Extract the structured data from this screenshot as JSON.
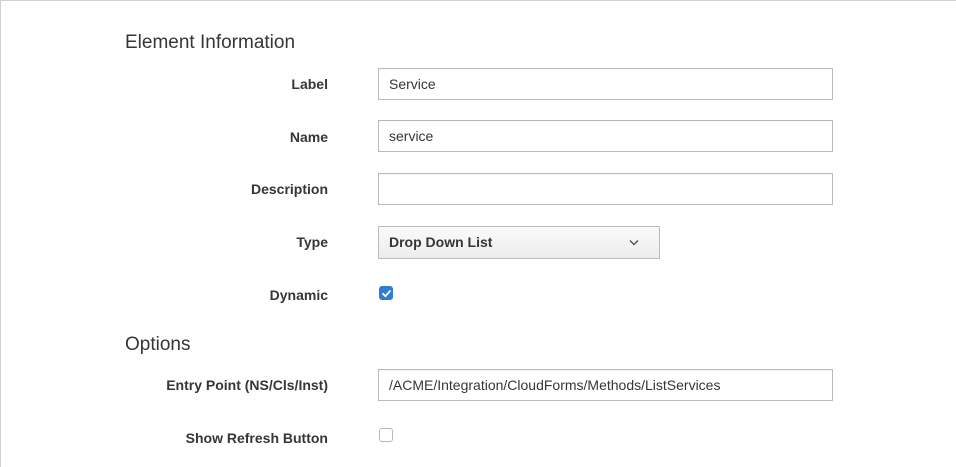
{
  "element_information": {
    "title": "Element Information",
    "label": {
      "label": "Label",
      "value": "Service"
    },
    "name": {
      "label": "Name",
      "value": "service"
    },
    "description": {
      "label": "Description",
      "value": ""
    },
    "type": {
      "label": "Type",
      "value": "Drop Down List",
      "icon": "chevron-down-icon"
    },
    "dynamic": {
      "label": "Dynamic",
      "checked": true
    }
  },
  "options": {
    "title": "Options",
    "entry_point": {
      "label": "Entry Point (NS/Cls/Inst)",
      "value": "/ACME/Integration/CloudForms/Methods/ListServices"
    },
    "show_refresh_button": {
      "label": "Show Refresh Button",
      "checked": false
    }
  },
  "colors": {
    "accent": "#2f7bd8",
    "text": "#363636",
    "border": "#bbbbbb"
  }
}
